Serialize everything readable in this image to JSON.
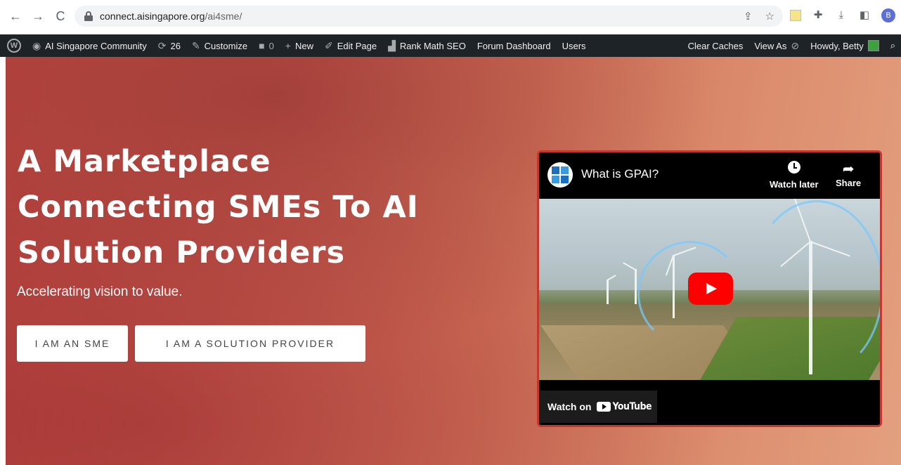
{
  "browser": {
    "back_icon": "arrow-left-icon",
    "forward_icon": "arrow-right-icon",
    "reload_icon": "reload-icon",
    "url_host": "connect.aisingapore.org",
    "url_path": "/ai4sme/",
    "share_icon": "share-icon",
    "star_icon": "bookmark-star-icon",
    "profile_initial": "B"
  },
  "admin_bar": {
    "site_name": "AI Singapore Community",
    "updates_count": "26",
    "customize": "Customize",
    "comments_count": "0",
    "new": "New",
    "edit_page": "Edit Page",
    "rank_math": "Rank Math SEO",
    "forum_dashboard": "Forum Dashboard",
    "users": "Users",
    "clear_caches": "Clear Caches",
    "view_as": "View As",
    "howdy": "Howdy, Betty"
  },
  "hero": {
    "title_line1": "A Marketplace",
    "title_line2": "Connecting SMEs To AI",
    "title_line3": "Solution Providers",
    "subtitle": "Accelerating vision to value.",
    "btn_sme": "I AM AN SME",
    "btn_provider": "I AM A SOLUTION PROVIDER"
  },
  "video": {
    "title": "What is GPAI?",
    "watch_later": "Watch later",
    "share": "Share",
    "watch_on": "Watch on",
    "youtube": "YouTube",
    "border_color": "#c2372e"
  }
}
